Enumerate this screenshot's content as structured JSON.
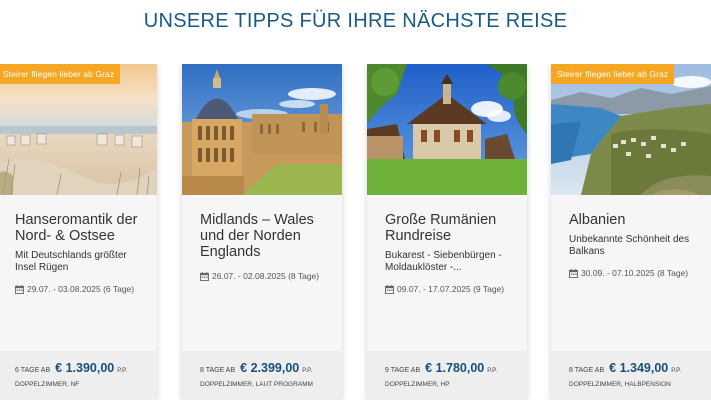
{
  "section": {
    "title": "UNSERE TIPPS FÜR IHRE NÄCHSTE REISE"
  },
  "colors": {
    "accent_blue": "#174f7d",
    "ribbon_orange": "#f5a623"
  },
  "cards": [
    {
      "ribbon": "Steirer fliegen lieber ab Graz",
      "image": "beach-dunes-baltic",
      "title": "Hanseromantik der Nord- & Ostsee",
      "subtitle": "Mit Deutschlands größter Insel Rügen",
      "dates": "29.07. - 03.08.2025 (6 Tage)",
      "days": "6 TAGE AB",
      "price": "€ 1.390,00",
      "pp": "P.P.",
      "room": "DOPPELZIMMER, NF"
    },
    {
      "ribbon": "",
      "image": "oxford-radcliffe-camera",
      "title": "Midlands – Wales und der Norden Englands",
      "subtitle": "",
      "dates": "26.07. - 02.08.2025 (8 Tage)",
      "days": "8 TAGE AB",
      "price": "€ 2.399,00",
      "pp": "P.P.",
      "room": "DOPPELZIMMER, LAUT PROGRAMM"
    },
    {
      "ribbon": "",
      "image": "romanian-monastery",
      "title": "Große Rumänien Rundreise",
      "subtitle": "Bukarest - Siebenbürgen - Moldauklöster -...",
      "dates": "09.07. - 17.07.2025 (9 Tage)",
      "days": "9 TAGE AB",
      "price": "€ 1.780,00",
      "pp": "P.P.",
      "room": "DOPPELZIMMER, HP"
    },
    {
      "ribbon": "Steirer fliegen lieber ab Graz",
      "image": "albanian-coast",
      "title": "Albanien",
      "subtitle": "Unbekannte Schönheit des Balkans",
      "dates": "30.09. - 07.10.2025 (8 Tage)",
      "days": "8 TAGE AB",
      "price": "€ 1.349,00",
      "pp": "P.P.",
      "room": "DOPPELZIMMER, HALBPENSION"
    }
  ]
}
